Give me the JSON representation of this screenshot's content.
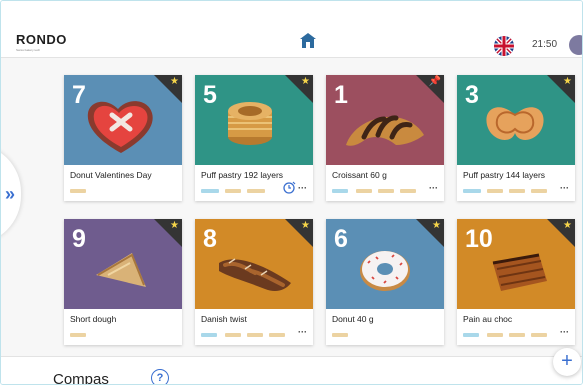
{
  "header": {
    "logo_text": "RONDO",
    "logo_subtext": "Swiss bakery tech",
    "clock": "21:50",
    "language": "English"
  },
  "products": [
    {
      "number": "7",
      "name": "Donut Valentines Day",
      "marker": "star"
    },
    {
      "number": "5",
      "name": "Puff pastry 192 layers",
      "marker": "star"
    },
    {
      "number": "1",
      "name": "Croissant 60 g",
      "marker": "pin"
    },
    {
      "number": "3",
      "name": "Puff pastry 144 layers",
      "marker": "star"
    },
    {
      "number": "9",
      "name": "Short dough",
      "marker": "star"
    },
    {
      "number": "8",
      "name": "Danish twist",
      "marker": "star"
    },
    {
      "number": "6",
      "name": "Donut 40 g",
      "marker": "star"
    },
    {
      "number": "10",
      "name": "Pain au choc",
      "marker": "star"
    }
  ],
  "more_label": "···",
  "sidebar": {
    "toggle_label": "»"
  },
  "footer": {
    "title": "Compas",
    "help_label": "?",
    "add_label": "+"
  },
  "colors": {
    "card_blue": "#5b8fb5",
    "card_teal": "#2f9486",
    "card_mauve": "#9c4f5f",
    "card_purple": "#6f5c8e",
    "card_orange": "#d28a27",
    "accent": "#3a6fd0",
    "star": "#f6d54a",
    "pin": "#e24f4f"
  }
}
